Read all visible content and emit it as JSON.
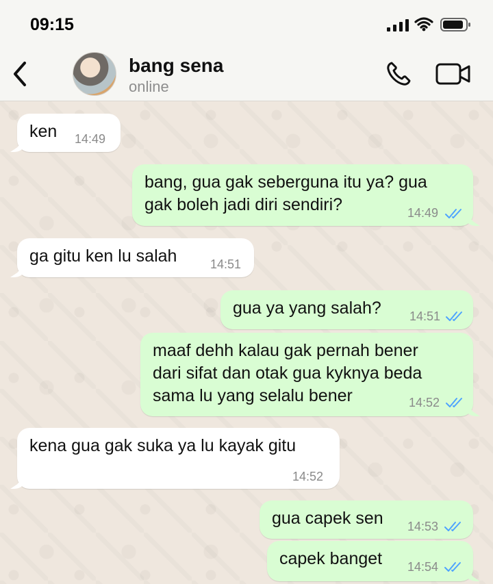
{
  "status_bar": {
    "time": "09:15"
  },
  "header": {
    "contact_name": "bang sena",
    "contact_status": "online",
    "back_icon": "chevron-left-icon",
    "call_icon": "phone-icon",
    "video_icon": "video-camera-icon"
  },
  "messages": [
    {
      "direction": "in",
      "text": "ken",
      "time": "14:49"
    },
    {
      "direction": "out",
      "text": "bang, gua gak seberguna itu ya? gua\ngak boleh jadi diri sendiri?",
      "time": "14:49",
      "read": true
    },
    {
      "direction": "in",
      "text": "ga gitu ken lu salah",
      "time": "14:51"
    },
    {
      "direction": "out",
      "text": "gua ya yang salah?",
      "time": "14:51",
      "read": true
    },
    {
      "direction": "out",
      "text": "maaf dehh kalau gak pernah bener\ndari sifat dan otak gua kyknya beda\nsama lu yang selalu bener",
      "time": "14:52",
      "read": true
    },
    {
      "direction": "in",
      "text": "kena gua gak suka ya lu kayak gitu",
      "time": "14:52"
    },
    {
      "direction": "out",
      "text": "gua capek sen",
      "time": "14:53",
      "read": true
    },
    {
      "direction": "out",
      "text": "capek banget",
      "time": "14:54",
      "read": true
    }
  ],
  "colors": {
    "chat_background": "#efe7de",
    "incoming_bubble": "#ffffff",
    "outgoing_bubble": "#d9fdd3",
    "read_ticks": "#4ea3ff"
  }
}
